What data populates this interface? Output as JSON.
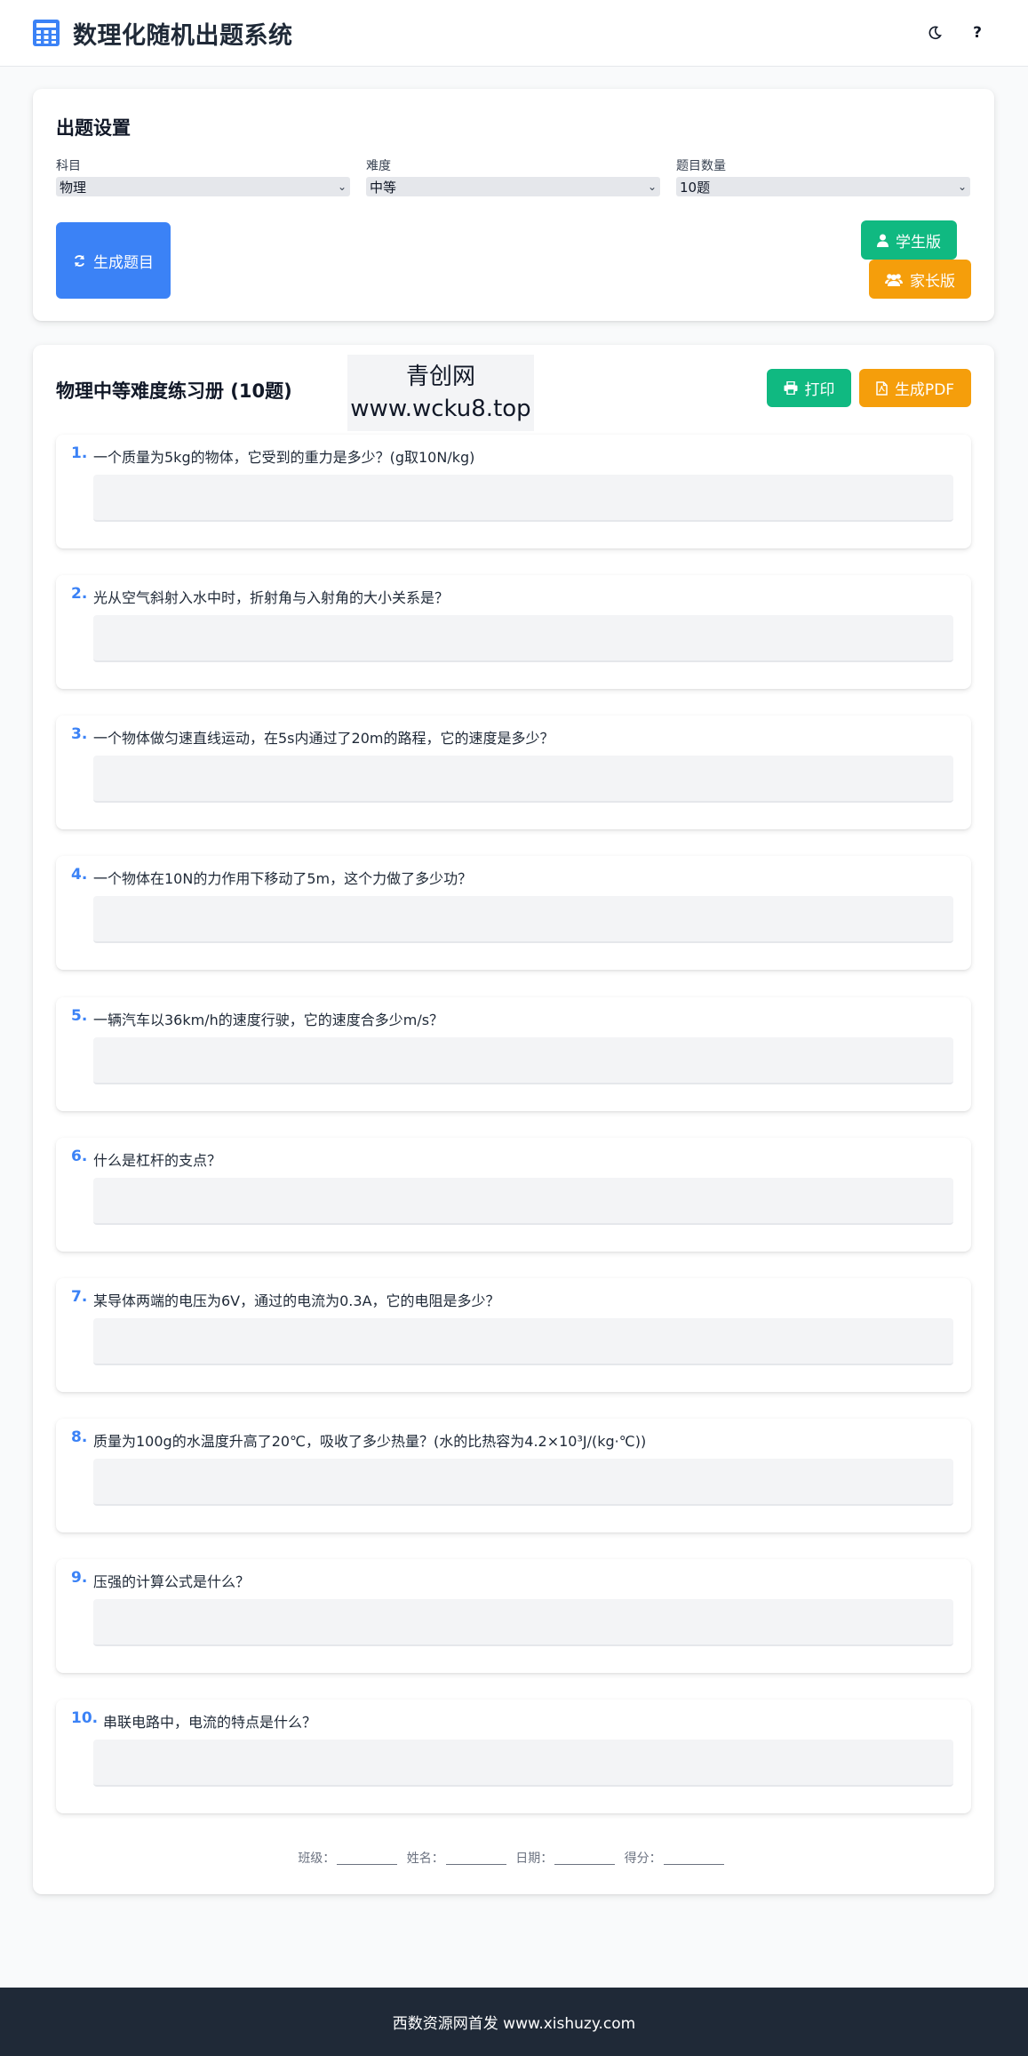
{
  "header": {
    "title": "数理化随机出题系统",
    "logo_icon": "calculator-icon",
    "theme_toggle_icon": "moon-icon",
    "help_label": "?"
  },
  "settings": {
    "title": "出题设置",
    "subject": {
      "label": "科目",
      "value": "物理"
    },
    "difficulty": {
      "label": "难度",
      "value": "中等"
    },
    "count": {
      "label": "题目数量",
      "value": "10题"
    },
    "generate_label": "生成题目",
    "student_label": "学生版",
    "parent_label": "家长版"
  },
  "sheet": {
    "title": "物理中等难度练习册 (10题)",
    "watermark_line1": "青创网",
    "watermark_line2": "www.wcku8.top",
    "print_label": "打印",
    "pdf_label": "生成PDF",
    "questions": [
      {
        "num": "1.",
        "text": "一个质量为5kg的物体，它受到的重力是多少？(g取10N/kg)"
      },
      {
        "num": "2.",
        "text": "光从空气斜射入水中时，折射角与入射角的大小关系是？"
      },
      {
        "num": "3.",
        "text": "一个物体做匀速直线运动，在5s内通过了20m的路程，它的速度是多少？"
      },
      {
        "num": "4.",
        "text": "一个物体在10N的力作用下移动了5m，这个力做了多少功？"
      },
      {
        "num": "5.",
        "text": "一辆汽车以36km/h的速度行驶，它的速度合多少m/s？"
      },
      {
        "num": "6.",
        "text": "什么是杠杆的支点？"
      },
      {
        "num": "7.",
        "text": "某导体两端的电压为6V，通过的电流为0.3A，它的电阻是多少？"
      },
      {
        "num": "8.",
        "text": "质量为100g的水温度升高了20℃，吸收了多少热量？(水的比热容为4.2×10³J/(kg·℃))"
      },
      {
        "num": "9.",
        "text": "压强的计算公式是什么？"
      },
      {
        "num": "10.",
        "text": "串联电路中，电流的特点是什么？"
      }
    ],
    "info": {
      "class_label": "班级：",
      "name_label": "姓名：",
      "date_label": "日期：",
      "score_label": "得分："
    }
  },
  "footer": {
    "text": "西数资源网首发 www.xishuzy.com"
  },
  "colors": {
    "primary": "#3b82f6",
    "success": "#10b981",
    "warning": "#f59e0b",
    "footer_bg": "#1f2937"
  }
}
